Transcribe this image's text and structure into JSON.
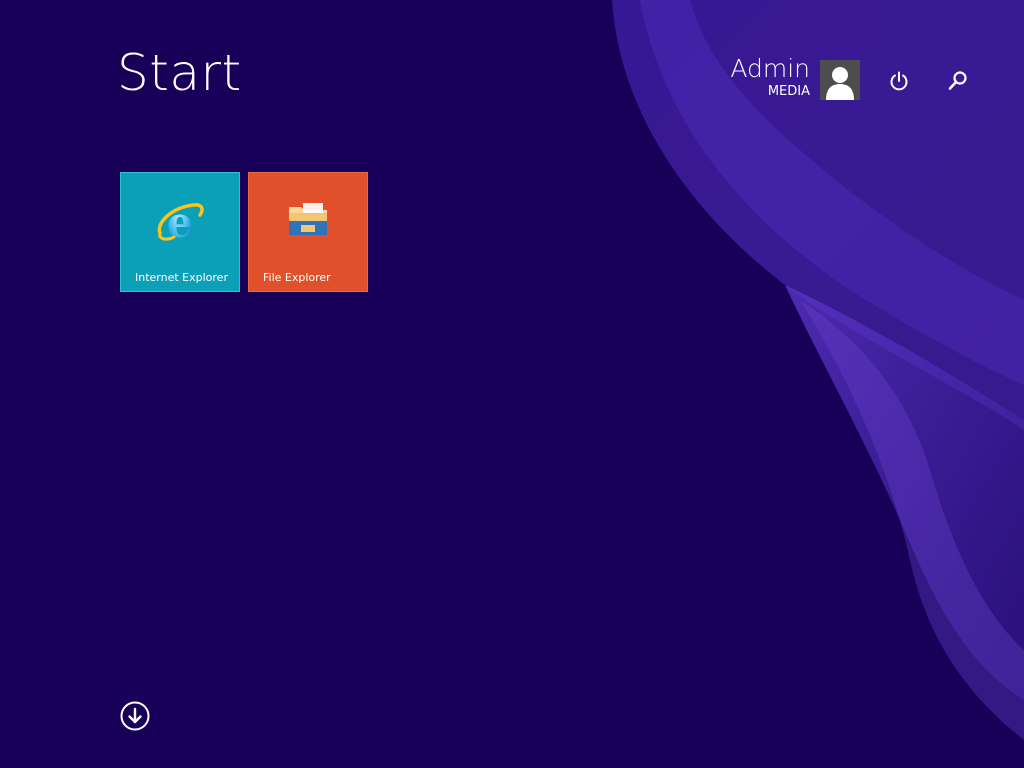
{
  "header": {
    "title": "Start"
  },
  "user": {
    "name": "Admin",
    "domain": "MEDIA"
  },
  "top_icons": {
    "power": "power-icon",
    "search": "search-icon"
  },
  "tiles": [
    {
      "label": "Internet Explorer",
      "icon": "internet-explorer-icon",
      "color": "#0aa0b8"
    },
    {
      "label": "File Explorer",
      "icon": "file-explorer-icon",
      "color": "#e0502a"
    }
  ],
  "footer": {
    "apps_icon": "arrow-down-circle-icon"
  },
  "colors": {
    "background": "#180059",
    "accent_swirl": "#5a2fc0"
  }
}
